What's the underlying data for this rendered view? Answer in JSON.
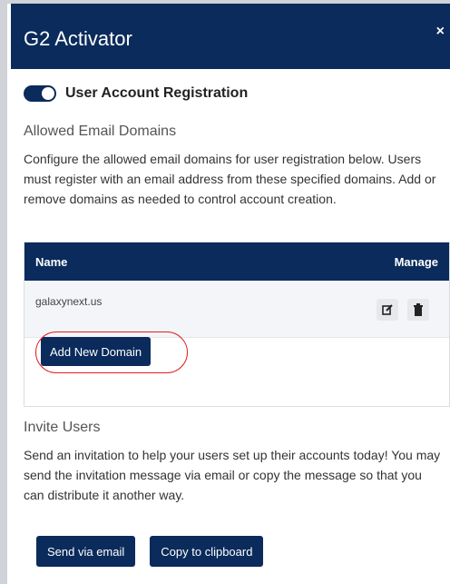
{
  "header": {
    "title": "G2 Activator",
    "close_label": "×"
  },
  "registration": {
    "label": "User Account Registration",
    "enabled": true
  },
  "allowed_domains": {
    "title": "Allowed Email Domains",
    "description": "Configure the allowed email domains for user registration below. Users must register with an email address from these specified domains. Add or remove domains as needed to control account creation.",
    "table": {
      "columns": [
        "Name",
        "Manage"
      ],
      "rows": [
        {
          "name": "galaxynext.us"
        }
      ]
    },
    "add_label": "Add New Domain"
  },
  "invite": {
    "title": "Invite Users",
    "description": "Send an invitation to help your users set up their accounts today! You may send the invitation message via email or copy the message so that you can distribute it another way.",
    "send_label": "Send via email",
    "copy_label": "Copy to clipboard"
  },
  "colors": {
    "primary": "#0a2b5b",
    "highlight": "#e02020"
  }
}
